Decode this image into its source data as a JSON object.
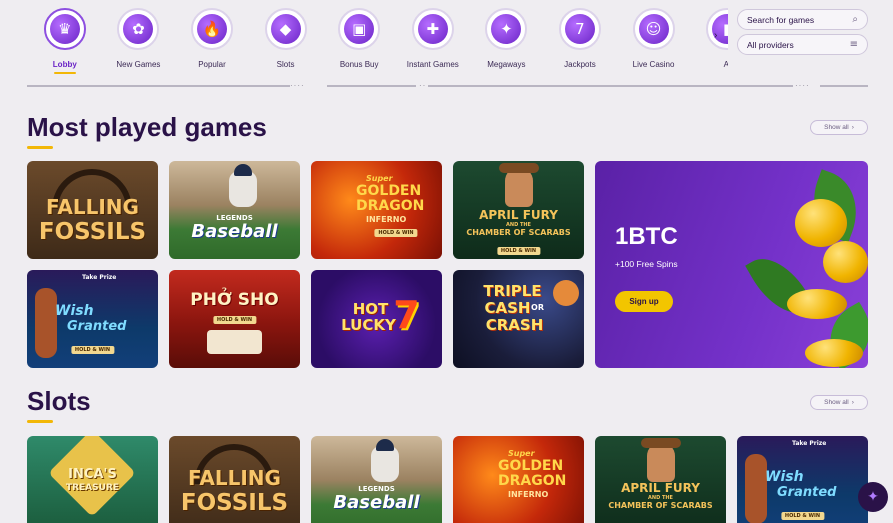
{
  "categories": [
    {
      "label": "Lobby",
      "icon": "crown-icon",
      "glyph": "♛",
      "active": true
    },
    {
      "label": "New Games",
      "icon": "new-games-icon",
      "glyph": "✿"
    },
    {
      "label": "Popular",
      "icon": "flame-icon",
      "glyph": "🔥"
    },
    {
      "label": "Slots",
      "icon": "gem-icon",
      "glyph": "◆"
    },
    {
      "label": "Bonus Buy",
      "icon": "gift-icon",
      "glyph": "▣"
    },
    {
      "label": "Instant Games",
      "icon": "gamepad-icon",
      "glyph": "✚"
    },
    {
      "label": "Megaways",
      "icon": "megaways-icon",
      "glyph": "✦"
    },
    {
      "label": "Jackpots",
      "icon": "jackpot-777-icon",
      "glyph": "7"
    },
    {
      "label": "Live Casino",
      "icon": "live-dealer-icon",
      "glyph": "☺"
    },
    {
      "label": "Al",
      "icon": "all-games-icon",
      "glyph": "▮"
    }
  ],
  "search": {
    "placeholder": "Search for games"
  },
  "providers": {
    "value": "All providers"
  },
  "sections": {
    "most_played": {
      "title": "Most played games",
      "show_all": "Show all"
    },
    "slots": {
      "title": "Slots",
      "show_all": "Show all"
    }
  },
  "games": {
    "falling_fossils": {
      "line1": "FALLING",
      "line2": "FOSSILS"
    },
    "legends_baseball": {
      "line1": "LEGENDS",
      "line2": "Baseball"
    },
    "golden_dragon": {
      "line1": "Super",
      "line2": "GOLDEN",
      "line3": "DRAGON",
      "line4": "INFERNO",
      "badge": "HOLD & WIN"
    },
    "april_fury": {
      "line1": "APRIL FURY",
      "line2": "AND THE",
      "line3": "CHAMBER OF SCARABS",
      "badge": "HOLD & WIN"
    },
    "wish_granted": {
      "top": "Take Prize",
      "line1": "Wish",
      "line2": "Granted",
      "badge": "HOLD & WIN"
    },
    "pho_sho": {
      "line1": "PHỞ SHO",
      "badge": "HOLD & WIN"
    },
    "hot_lucky": {
      "line1": "HOT",
      "line2": "LUCKY",
      "num": "7"
    },
    "triple_cash": {
      "line1": "TRIPLE",
      "line2": "CASH",
      "line3": "OR",
      "line4": "CRASH"
    },
    "incas_treasure": {
      "line1": "INCA'S",
      "line2": "TREASURE"
    }
  },
  "promo": {
    "title": "1BTC",
    "subtitle": "+100 Free Spins",
    "button": "Sign up"
  },
  "colors": {
    "accent": "#6a24c6",
    "underline": "#f2b707",
    "promo": "#7431c9",
    "button": "#f2c500"
  }
}
